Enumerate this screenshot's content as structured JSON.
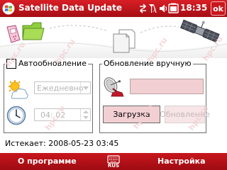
{
  "titlebar": {
    "title": "Satellite Data Update",
    "time": "18:35",
    "ok_label": "ok",
    "icons": [
      "windows-flag-icon",
      "connectivity-icon",
      "signal-icon",
      "volume-icon",
      "battery-icon"
    ]
  },
  "auto_group": {
    "checkbox_label": "Автообновление",
    "checked": false,
    "frequency_value": "Ежедневно",
    "time_value": "04: 02"
  },
  "manual_group": {
    "legend": "Обновление вручную",
    "url_value": "",
    "download_label": "Загрузка",
    "update_label": "Обновление"
  },
  "expires_text": "Истекает: 2008-05-23 03:45",
  "bottombar": {
    "left_soft_key": "О программе",
    "right_soft_key": "Настройка",
    "input_indicator": "RUS"
  },
  "watermark_text": "hpc.ru",
  "colors": {
    "titlebar_red": "#c8161d",
    "input_pink": "#f1cfd3",
    "disabled_text": "#b5b5b5"
  }
}
